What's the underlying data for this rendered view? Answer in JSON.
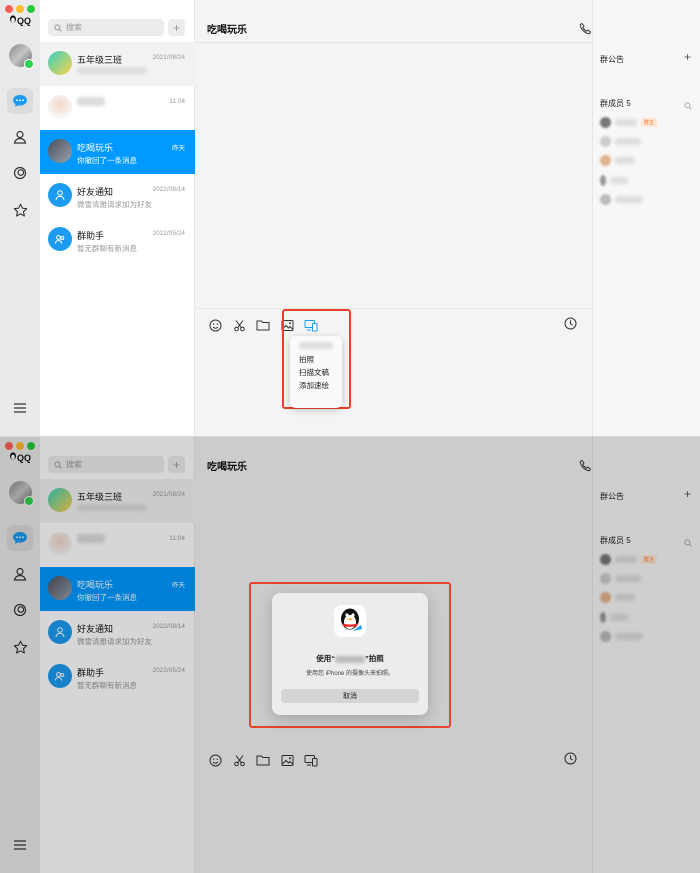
{
  "app": {
    "brand": "QQ"
  },
  "search": {
    "placeholder": "搜索",
    "add": "+"
  },
  "chats": [
    {
      "name": "五年级三班",
      "time": "2021/08/24",
      "msg": ""
    },
    {
      "name": "",
      "time": "11:04",
      "msg": ""
    },
    {
      "name": "吃喝玩乐",
      "time": "昨天",
      "msg": "你撤回了一条消息"
    },
    {
      "name": "好友通知",
      "time": "2022/08/14",
      "msg": "微雪清雅请求加为好友"
    },
    {
      "name": "群助手",
      "time": "2022/05/24",
      "msg": "暂无群聊有新消息"
    }
  ],
  "chat": {
    "title": "吃喝玩乐"
  },
  "panel": {
    "notice": "群公告",
    "members": "群成员 5",
    "owner_badge": "群主",
    "plus": "+"
  },
  "menu": {
    "items": [
      "拍照",
      "扫描文稿",
      "添加速绘"
    ]
  },
  "dialog": {
    "title_prefix": "使用“",
    "title_suffix": "”拍照",
    "subtitle": "使用您 iPhone 的摄像头来拍照。",
    "cancel": "取消"
  },
  "colors": {
    "accent": "#0099ff",
    "highlight": "#e8412c",
    "online": "#2bd14b"
  }
}
